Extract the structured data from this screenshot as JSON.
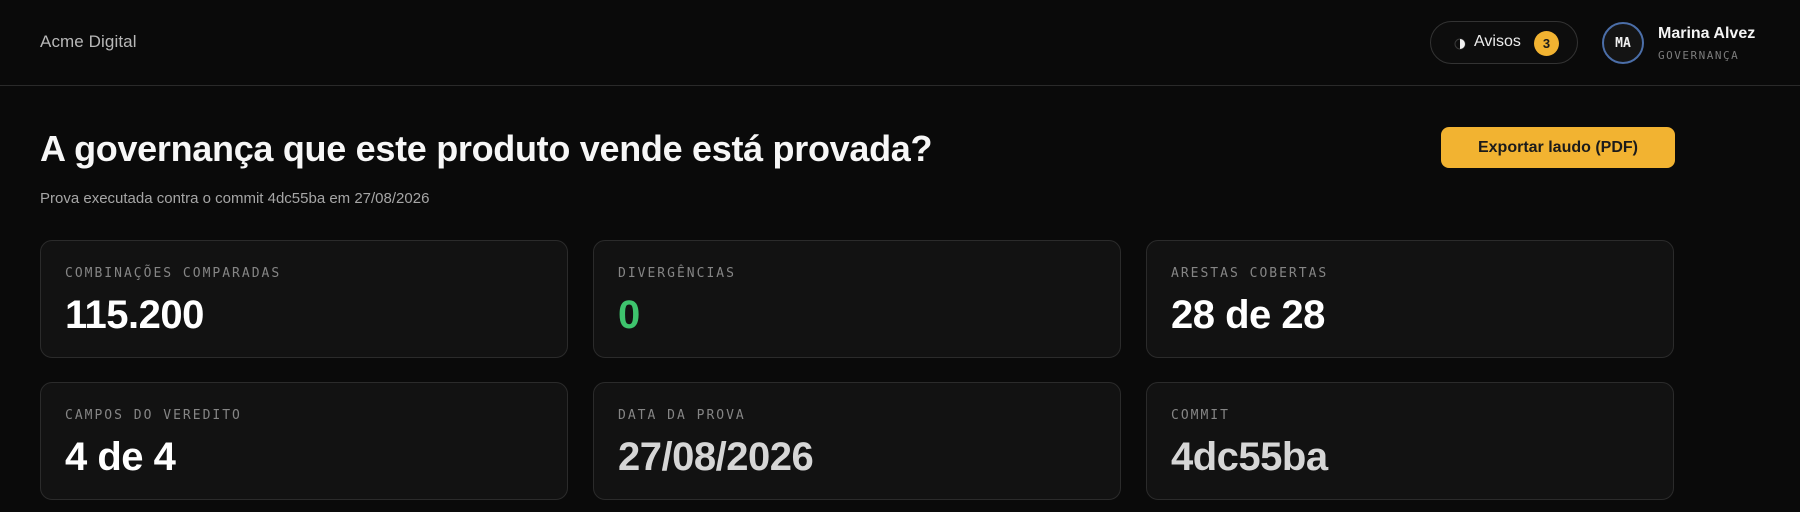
{
  "header": {
    "brand": "Acme Digital",
    "notices": {
      "label": "Avisos",
      "count": "3",
      "icon": "half-circle-icon"
    },
    "user": {
      "initials": "MA",
      "name": "Marina Alvez",
      "role": "GOVERNANÇA"
    }
  },
  "main": {
    "title": "A governança que este produto vende está provada?",
    "subtitle": "Prova executada contra o commit 4dc55ba em 27/08/2026",
    "export_label": "Exportar laudo (PDF)",
    "cards": [
      {
        "label": "COMBINAÇÕES COMPARADAS",
        "value": "115.200",
        "value_color": "#ffffff"
      },
      {
        "label": "DIVERGÊNCIAS",
        "value": "0",
        "value_color": "#3ec46d"
      },
      {
        "label": "ARESTAS COBERTAS",
        "value": "28 de 28",
        "value_color": "#ffffff"
      },
      {
        "label": "CAMPOS DO VEREDITO",
        "value": "4 de 4",
        "value_color": "#ffffff"
      },
      {
        "label": "DATA DA PROVA",
        "value": "27/08/2026",
        "value_color": "#d6d6d6"
      },
      {
        "label": "COMMIT",
        "value": "4dc55ba",
        "value_color": "#d6d6d6"
      }
    ]
  },
  "colors": {
    "accent": "#f2b331",
    "success": "#3ec46d",
    "background": "#0a0a0a",
    "card_background": "#121212"
  }
}
